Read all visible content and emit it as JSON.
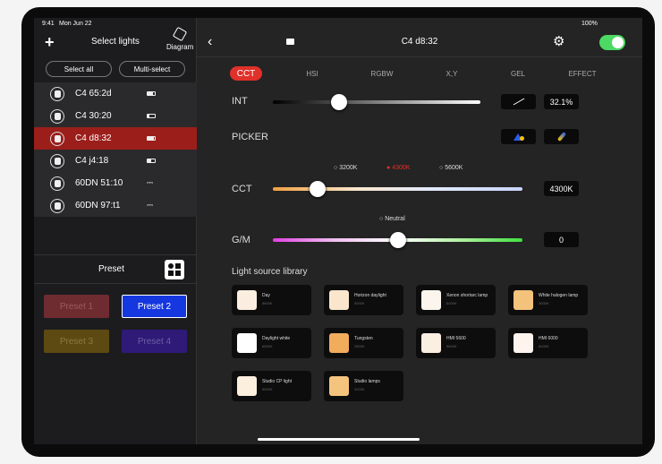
{
  "status": {
    "time": "9:41",
    "date": "Mon Jun 22",
    "battery": "100%"
  },
  "sidebar": {
    "title": "Select lights",
    "diagram_label": "Diagram",
    "select_all": "Select all",
    "multi_select": "Multi-select",
    "lights": [
      {
        "name": "C4 65:2d",
        "type": "panel",
        "power": "battery",
        "level": 0.8
      },
      {
        "name": "C4 30:20",
        "type": "panel",
        "power": "battery",
        "level": 0.2
      },
      {
        "name": "C4 d8:32",
        "type": "panel",
        "power": "battery",
        "level": 0.9,
        "selected": true
      },
      {
        "name": "C4 j4:18",
        "type": "panel",
        "power": "battery",
        "level": 0.5
      },
      {
        "name": "60DN 51:10",
        "type": "spot",
        "power": "plug"
      },
      {
        "name": "60DN 97:t1",
        "type": "spot",
        "power": "plug"
      }
    ],
    "preset_title": "Preset",
    "presets": [
      {
        "label": "Preset 1",
        "color": "#6e2b30",
        "text": "#9a5b5f"
      },
      {
        "label": "Preset 2",
        "color": "#1537e0",
        "text": "#ffffff",
        "active": true
      },
      {
        "label": "Preset 3",
        "color": "#5c4a12",
        "text": "#8a7a3e"
      },
      {
        "label": "Preset 4",
        "color": "#2f1a78",
        "text": "#6d5fa6"
      }
    ]
  },
  "header": {
    "title": "C4 d8:32",
    "power_on": true
  },
  "tabs": [
    "CCT",
    "HSI",
    "RGBW",
    "X,Y",
    "GEL",
    "EFFECT"
  ],
  "int": {
    "label": "INT",
    "value": "32.1%",
    "fraction": 0.321
  },
  "picker": {
    "label": "PICKER"
  },
  "cct": {
    "label": "CCT",
    "value": "4300K",
    "fraction": 0.18,
    "marks": [
      "3200K",
      "4300K",
      "5600K"
    ]
  },
  "gm": {
    "label": "G/M",
    "value": "0",
    "fraction": 0.5,
    "mark": "Neutral"
  },
  "library": {
    "title": "Light source library",
    "items": [
      {
        "name": "Day",
        "cct": "5600K",
        "color": "#fbeee0"
      },
      {
        "name": "Horizon daylight",
        "cct": "5000K",
        "color": "#f9e6cc"
      },
      {
        "name": "Xenon shortarc lamp",
        "cct": "6000K",
        "color": "#fcf5ee"
      },
      {
        "name": "White halogen lamp",
        "cct": "3000K",
        "color": "#f3c27b"
      },
      {
        "name": "Daylight white",
        "cct": "6500K",
        "color": "#ffffff"
      },
      {
        "name": "Tungsten",
        "cct": "2500K",
        "color": "#f1ac5c"
      },
      {
        "name": "HMI 5600",
        "cct": "5600K",
        "color": "#fbefe2"
      },
      {
        "name": "HMI 6000",
        "cct": "6000K",
        "color": "#fdf4ee"
      },
      {
        "name": "Studio CP light",
        "cct": "5500K",
        "color": "#fcefde"
      },
      {
        "name": "Studio lamps",
        "cct": "3200K",
        "color": "#f4c47e"
      }
    ]
  },
  "colors": {
    "accent": "#e0302a",
    "selected_row": "#9b1e1a",
    "toggle": "#4cd964"
  }
}
